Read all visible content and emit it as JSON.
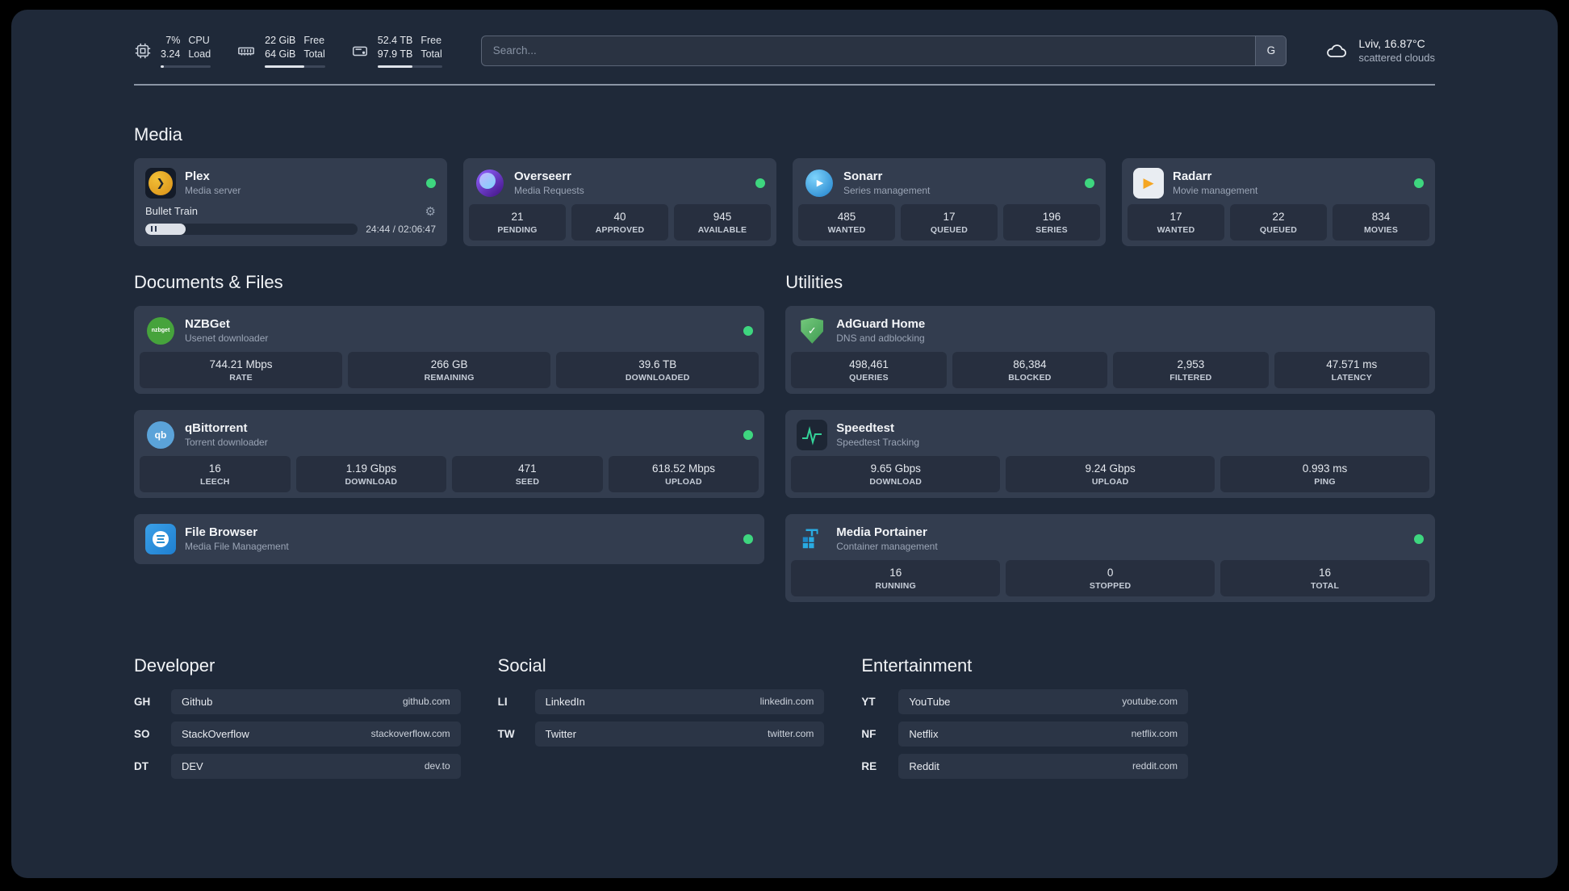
{
  "topbar": {
    "cpu": {
      "value1": "7%",
      "value2": "3.24",
      "label1": "CPU",
      "label2": "Load",
      "pct": 7
    },
    "ram": {
      "value1": "22 GiB",
      "value2": "64 GiB",
      "label1": "Free",
      "label2": "Total",
      "pct": 66
    },
    "disk": {
      "value1": "52.4 TB",
      "value2": "97.9 TB",
      "label1": "Free",
      "label2": "Total",
      "pct": 54
    },
    "search": {
      "placeholder": "Search...",
      "button_label": "G"
    },
    "weather": {
      "location": "Lviv, 16.87°C",
      "condition": "scattered clouds"
    }
  },
  "sections": {
    "media": {
      "title": "Media"
    },
    "documents": {
      "title": "Documents & Files"
    },
    "utilities": {
      "title": "Utilities"
    }
  },
  "apps": {
    "plex": {
      "name": "Plex",
      "desc": "Media server",
      "now_playing": "Bullet Train",
      "time": "24:44 / 02:06:47",
      "progress_pct": 19
    },
    "overseerr": {
      "name": "Overseerr",
      "desc": "Media Requests",
      "stats": [
        {
          "value": "21",
          "label": "PENDING"
        },
        {
          "value": "40",
          "label": "APPROVED"
        },
        {
          "value": "945",
          "label": "AVAILABLE"
        }
      ]
    },
    "sonarr": {
      "name": "Sonarr",
      "desc": "Series management",
      "stats": [
        {
          "value": "485",
          "label": "WANTED"
        },
        {
          "value": "17",
          "label": "QUEUED"
        },
        {
          "value": "196",
          "label": "SERIES"
        }
      ]
    },
    "radarr": {
      "name": "Radarr",
      "desc": "Movie management",
      "stats": [
        {
          "value": "17",
          "label": "WANTED"
        },
        {
          "value": "22",
          "label": "QUEUED"
        },
        {
          "value": "834",
          "label": "MOVIES"
        }
      ]
    },
    "nzbget": {
      "name": "NZBGet",
      "desc": "Usenet downloader",
      "stats": [
        {
          "value": "744.21 Mbps",
          "label": "RATE"
        },
        {
          "value": "266 GB",
          "label": "REMAINING"
        },
        {
          "value": "39.6 TB",
          "label": "DOWNLOADED"
        }
      ]
    },
    "qbittorrent": {
      "name": "qBittorrent",
      "desc": "Torrent downloader",
      "stats": [
        {
          "value": "16",
          "label": "LEECH"
        },
        {
          "value": "1.19 Gbps",
          "label": "DOWNLOAD"
        },
        {
          "value": "471",
          "label": "SEED"
        },
        {
          "value": "618.52 Mbps",
          "label": "UPLOAD"
        }
      ]
    },
    "filebrowser": {
      "name": "File Browser",
      "desc": "Media File Management"
    },
    "adguard": {
      "name": "AdGuard Home",
      "desc": "DNS and adblocking",
      "stats": [
        {
          "value": "498,461",
          "label": "QUERIES"
        },
        {
          "value": "86,384",
          "label": "BLOCKED"
        },
        {
          "value": "2,953",
          "label": "FILTERED"
        },
        {
          "value": "47.571 ms",
          "label": "LATENCY"
        }
      ]
    },
    "speedtest": {
      "name": "Speedtest",
      "desc": "Speedtest Tracking",
      "stats": [
        {
          "value": "9.65 Gbps",
          "label": "DOWNLOAD"
        },
        {
          "value": "9.24 Gbps",
          "label": "UPLOAD"
        },
        {
          "value": "0.993 ms",
          "label": "PING"
        }
      ]
    },
    "portainer": {
      "name": "Media Portainer",
      "desc": "Container management",
      "stats": [
        {
          "value": "16",
          "label": "RUNNING"
        },
        {
          "value": "0",
          "label": "STOPPED"
        },
        {
          "value": "16",
          "label": "TOTAL"
        }
      ]
    }
  },
  "icon_labels": {
    "plex": "❯",
    "nzbget": "nzbget",
    "qb": "qb",
    "sonarr": "▶",
    "radarr": "▶",
    "adguard": "✓",
    "gear": "⚙"
  },
  "bookmarks": {
    "developer": {
      "title": "Developer",
      "items": [
        {
          "abbr": "GH",
          "name": "Github",
          "url": "github.com"
        },
        {
          "abbr": "SO",
          "name": "StackOverflow",
          "url": "stackoverflow.com"
        },
        {
          "abbr": "DT",
          "name": "DEV",
          "url": "dev.to"
        }
      ]
    },
    "social": {
      "title": "Social",
      "items": [
        {
          "abbr": "LI",
          "name": "LinkedIn",
          "url": "linkedin.com"
        },
        {
          "abbr": "TW",
          "name": "Twitter",
          "url": "twitter.com"
        }
      ]
    },
    "entertainment": {
      "title": "Entertainment",
      "items": [
        {
          "abbr": "YT",
          "name": "YouTube",
          "url": "youtube.com"
        },
        {
          "abbr": "NF",
          "name": "Netflix",
          "url": "netflix.com"
        },
        {
          "abbr": "RE",
          "name": "Reddit",
          "url": "reddit.com"
        }
      ]
    }
  }
}
